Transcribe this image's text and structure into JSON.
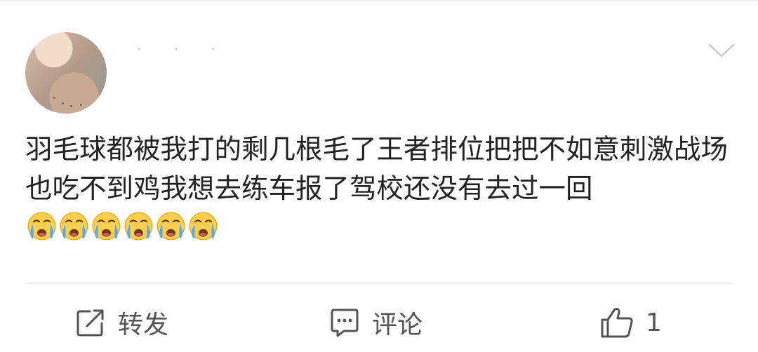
{
  "post": {
    "username": "· · ·",
    "content": "羽毛球都被我打的剩几根毛了王者排位把把不如意刺激战场也吃不到鸡我想去练车报了驾校还没有去过一回",
    "emoji": [
      "crying-face",
      "crying-face",
      "crying-face",
      "crying-face",
      "crying-face",
      "crying-face"
    ]
  },
  "actions": {
    "forward_label": "转发",
    "comment_label": "评论",
    "like_count": "1"
  },
  "icons": {
    "menu": "chevron-down-icon",
    "forward": "share-icon",
    "comment": "comment-icon",
    "like": "thumbs-up-icon"
  },
  "colors": {
    "text": "#222222",
    "secondary": "#555555",
    "divider": "#efefef",
    "emoji_face": "#fbcf4d",
    "emoji_tears": "#5aa9e6"
  }
}
